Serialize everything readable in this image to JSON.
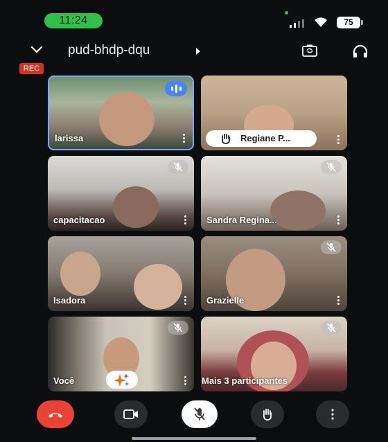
{
  "status_bar": {
    "time": "11:24",
    "battery": "75"
  },
  "header": {
    "meeting_code": "pud-bhdp-dqu",
    "rec_label": "REC"
  },
  "tiles": [
    {
      "name": "larissa",
      "state": "speaking"
    },
    {
      "name": "Regiane P...",
      "state": "hand-raised"
    },
    {
      "name": "capacitacao",
      "state": "muted"
    },
    {
      "name": "Sandra Regina...",
      "state": "muted"
    },
    {
      "name": "Isadora",
      "state": "unmuted"
    },
    {
      "name": "Grazielle",
      "state": "muted"
    },
    {
      "name": "Você",
      "state": "muted"
    },
    {
      "name": "Mais 3 participantes",
      "state": "muted"
    }
  ],
  "controls": [
    "end-call",
    "camera",
    "microphone-muted",
    "raise-hand",
    "more-options"
  ],
  "colors": {
    "end_call": "#ea4335",
    "speaking": "#4b84f5",
    "time_pill": "#2fbf4a",
    "rec": "#d93025"
  }
}
